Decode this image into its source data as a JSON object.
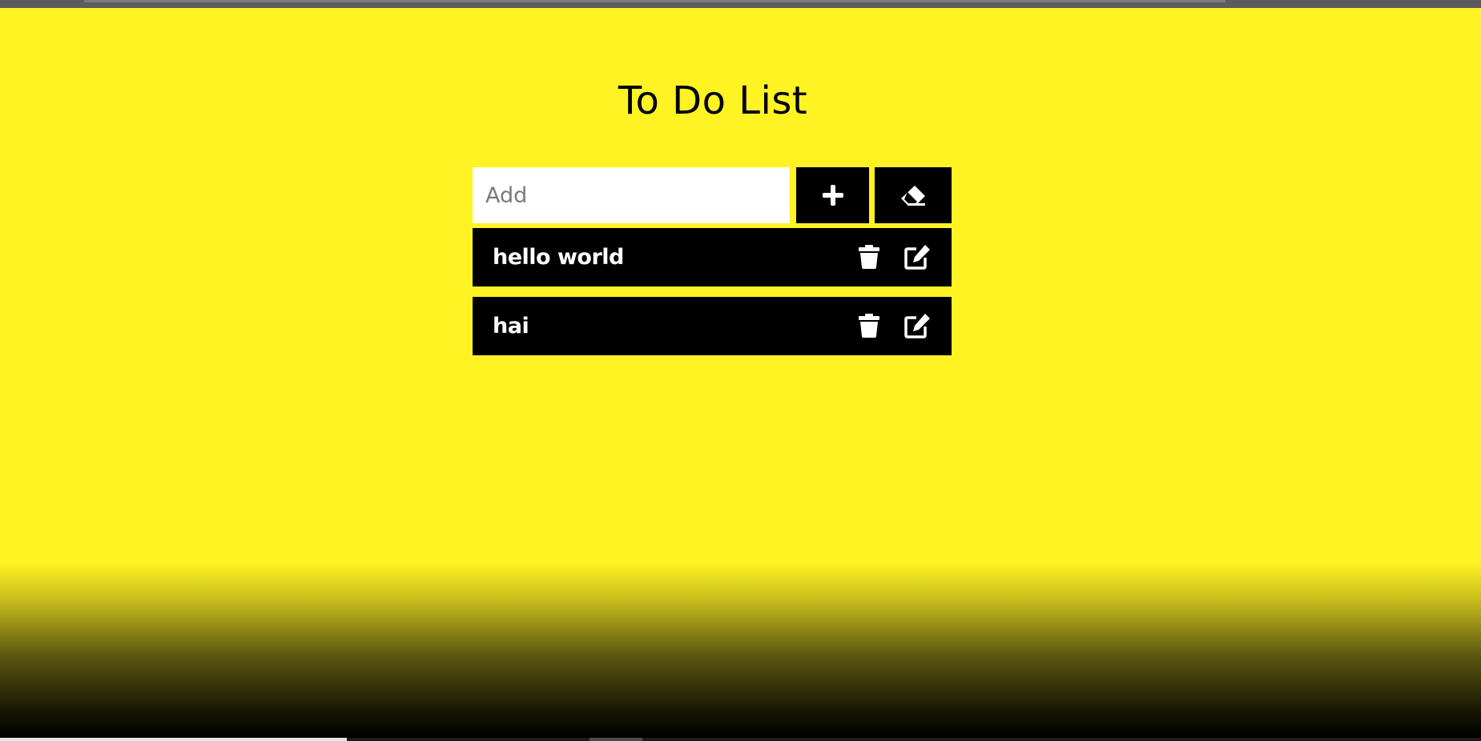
{
  "app": {
    "title": "To Do List",
    "accent_color": "#fff323",
    "item_background": "#000000"
  },
  "add_form": {
    "input_value": "",
    "input_placeholder": "Add",
    "add_button_icon": "plus-icon",
    "clear_button_icon": "eraser-icon"
  },
  "todos": [
    {
      "text": "hello world",
      "delete_icon": "trash-icon",
      "edit_icon": "edit-icon"
    },
    {
      "text": "hai",
      "delete_icon": "trash-icon",
      "edit_icon": "edit-icon"
    }
  ]
}
